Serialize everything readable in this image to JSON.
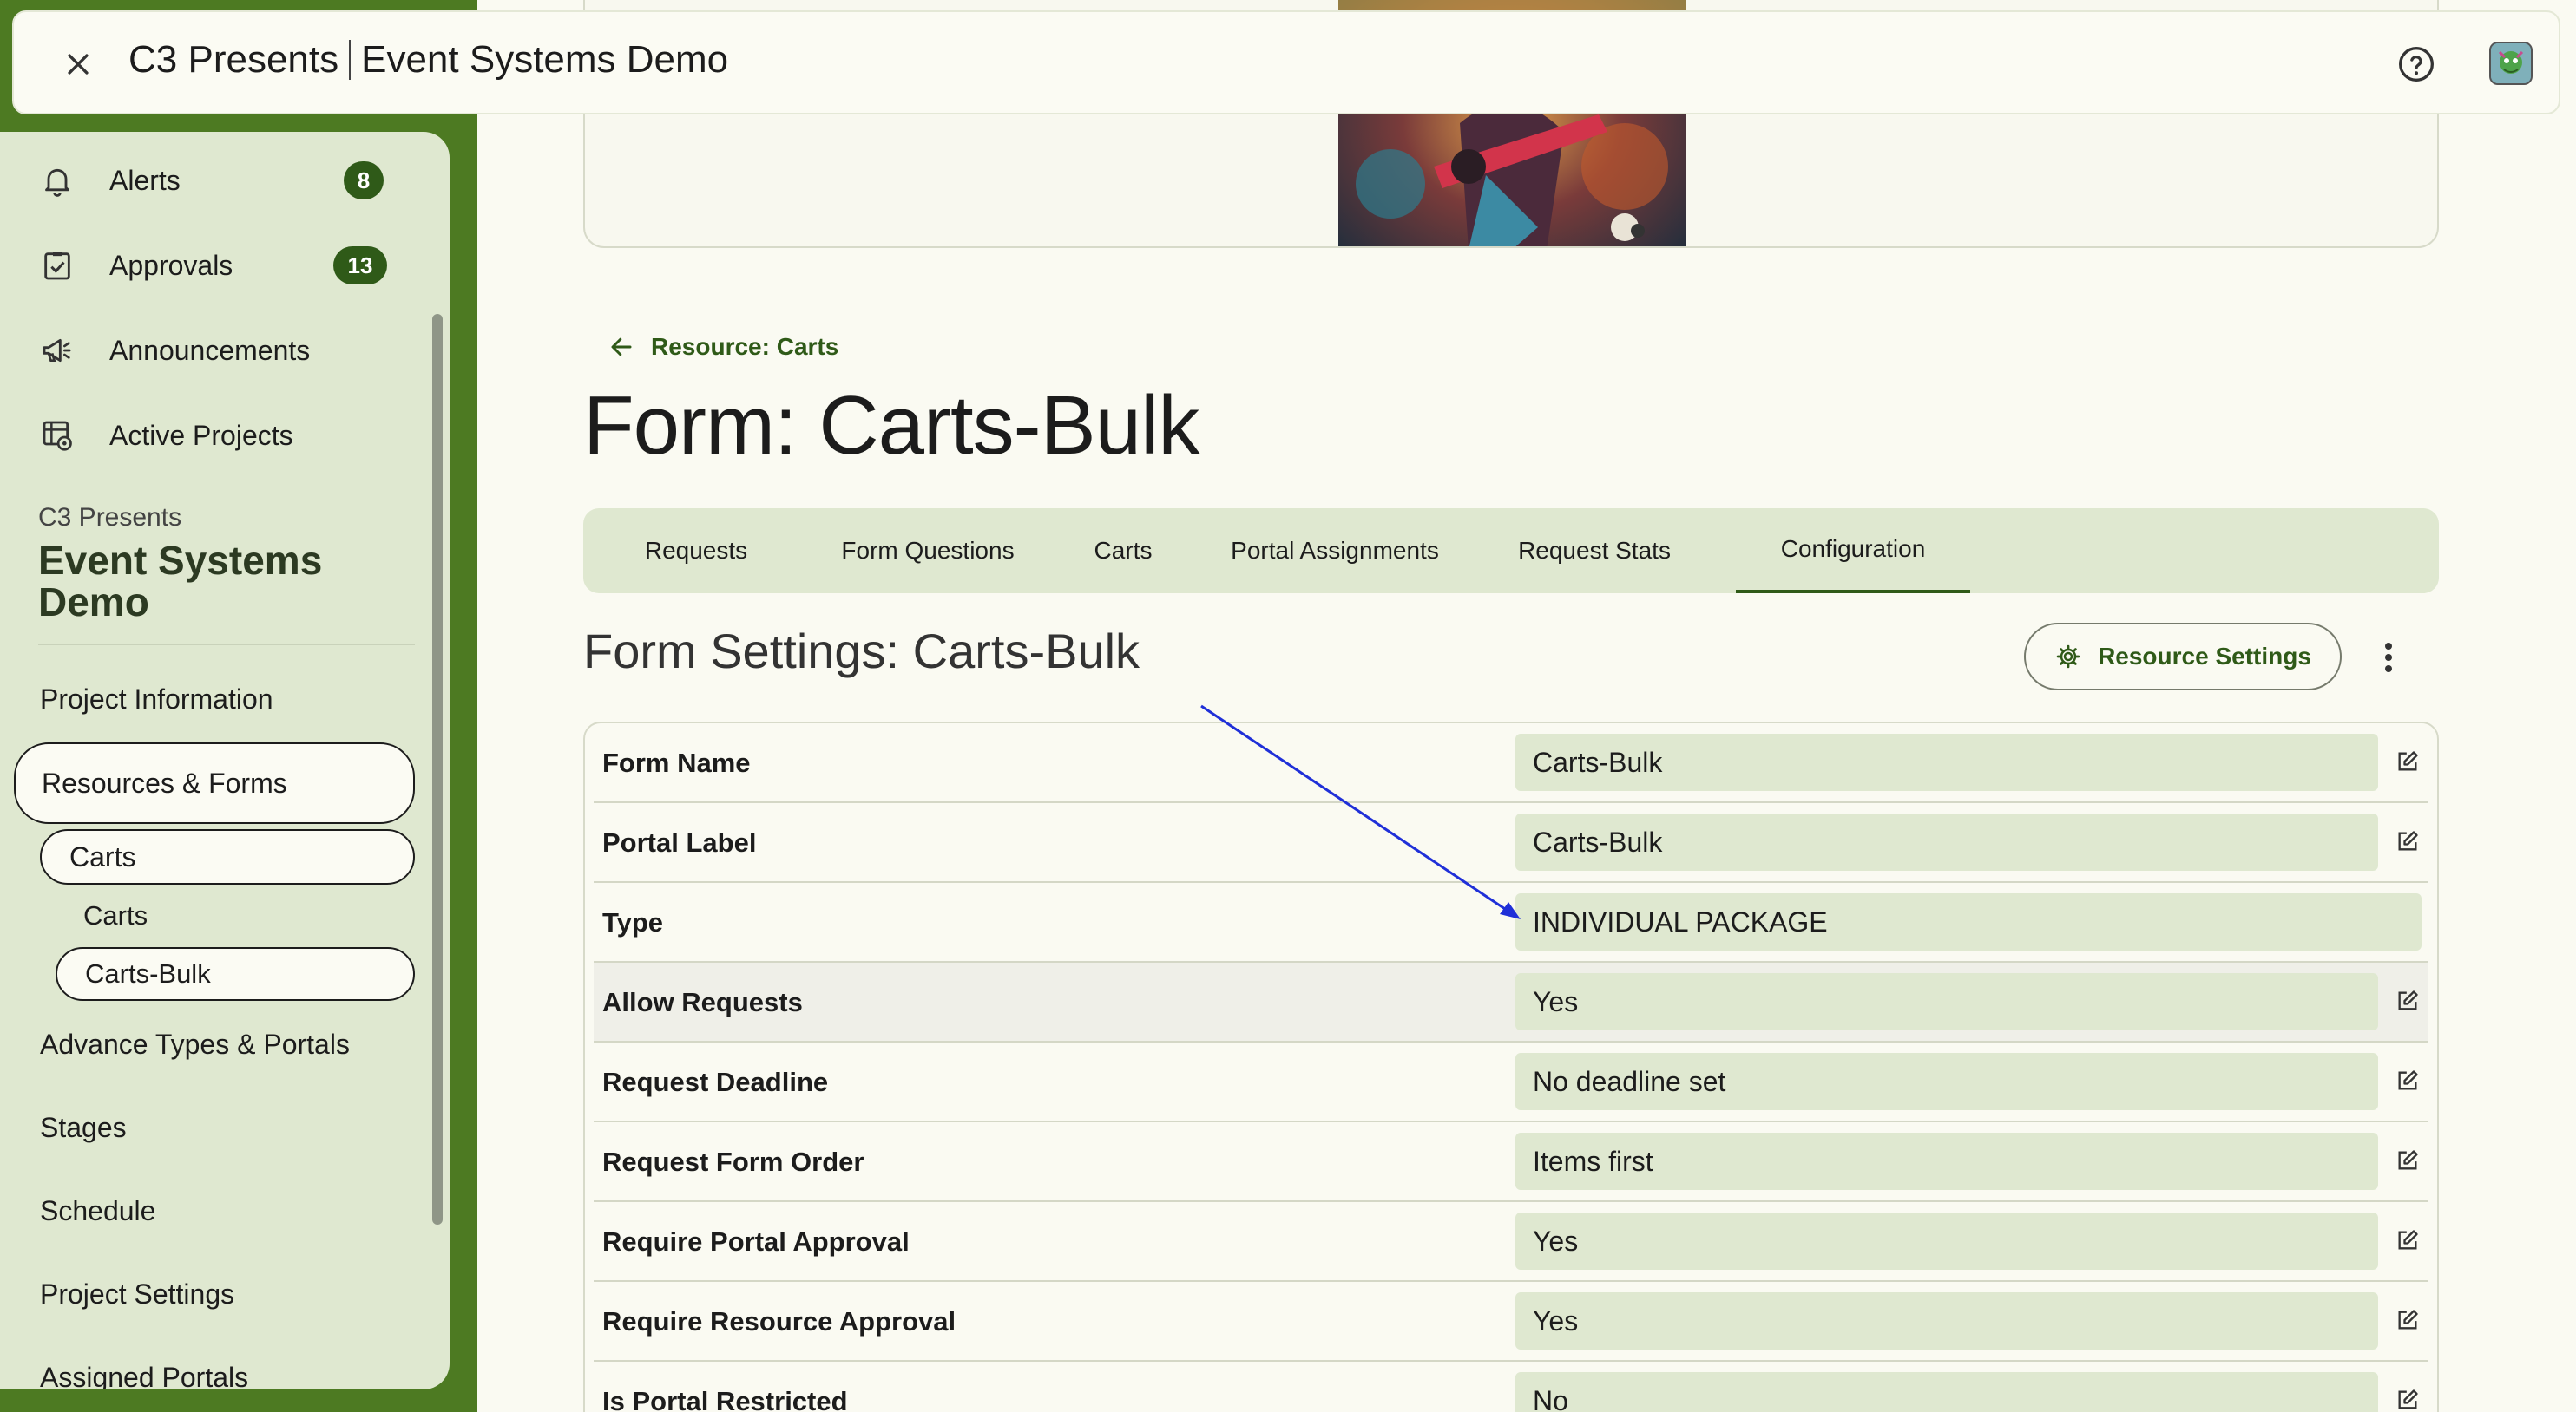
{
  "topbar": {
    "org": "C3 Presents",
    "project": "Event Systems Demo"
  },
  "sidebar": {
    "nav": [
      {
        "label": "Alerts",
        "badge": "8",
        "icon": "bell-icon"
      },
      {
        "label": "Approvals",
        "badge": "13",
        "icon": "clipboard-check-icon"
      },
      {
        "label": "Announcements",
        "icon": "megaphone-icon"
      },
      {
        "label": "Active Projects",
        "icon": "projects-icon"
      }
    ],
    "org_label": "C3 Presents",
    "project_name": "Event Systems Demo",
    "links": {
      "project_information": "Project Information",
      "resources_forms": "Resources & Forms",
      "carts_group": "Carts",
      "carts": "Carts",
      "carts_bulk": "Carts-Bulk",
      "advance_types": "Advance Types & Portals",
      "stages": "Stages",
      "schedule": "Schedule",
      "project_settings": "Project Settings",
      "assigned_portals": "Assigned Portals"
    }
  },
  "main": {
    "back_link": "Resource: Carts",
    "title": "Form: Carts-Bulk",
    "tabs": [
      {
        "label": "Requests"
      },
      {
        "label": "Form Questions"
      },
      {
        "label": "Carts"
      },
      {
        "label": "Portal Assignments"
      },
      {
        "label": "Request Stats"
      },
      {
        "label": "Configuration",
        "active": true
      }
    ],
    "section_title": "Form Settings: Carts-Bulk",
    "resource_settings_label": "Resource Settings",
    "settings": [
      {
        "label": "Form Name",
        "value": "Carts-Bulk",
        "editable": true
      },
      {
        "label": "Portal Label",
        "value": "Carts-Bulk",
        "editable": true
      },
      {
        "label": "Type",
        "value": "INDIVIDUAL PACKAGE",
        "editable": false
      },
      {
        "label": "Allow Requests",
        "value": "Yes",
        "editable": true
      },
      {
        "label": "Request Deadline",
        "value": "No deadline set",
        "editable": true
      },
      {
        "label": "Request Form Order",
        "value": "Items first",
        "editable": true
      },
      {
        "label": "Require Portal Approval",
        "value": "Yes",
        "editable": true
      },
      {
        "label": "Require Resource Approval",
        "value": "Yes",
        "editable": true
      },
      {
        "label": "Is Portal Restricted",
        "value": "No",
        "editable": true
      }
    ]
  },
  "colors": {
    "brand_green": "#4d7a22",
    "accent_dark_green": "#2f5a18",
    "sidebar_bg": "#dfe8d0",
    "field_bg": "#dfe8d0",
    "annotation_arrow": "#1f2fd8"
  }
}
